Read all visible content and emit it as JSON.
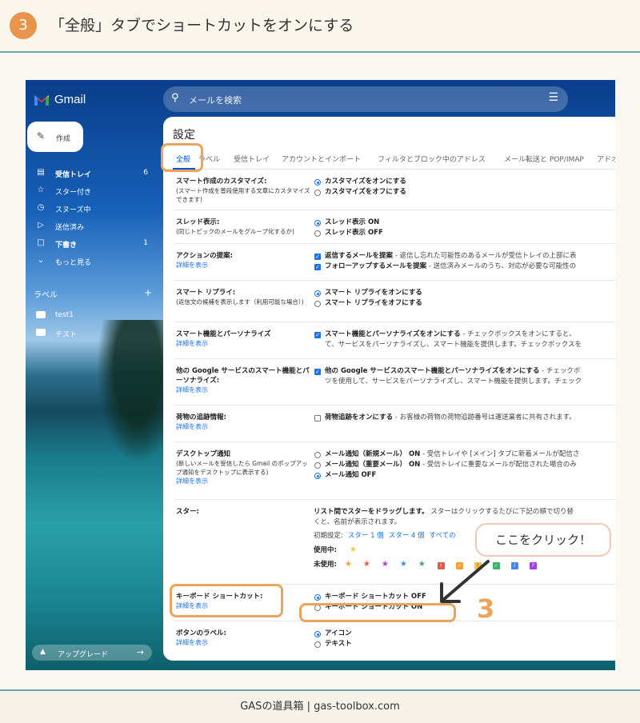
{
  "header": {
    "step": "3",
    "title": "「全般」タブでショートカットをオンにする"
  },
  "gmail": {
    "brand": "Gmail",
    "search_placeholder": "メールを検索",
    "compose": "作成",
    "nav": [
      {
        "label": "受信トレイ",
        "count": "6",
        "icon": "inbox-icon"
      },
      {
        "label": "スター付き",
        "count": "",
        "icon": "star-icon"
      },
      {
        "label": "スヌーズ中",
        "count": "",
        "icon": "clock-icon"
      },
      {
        "label": "送信済み",
        "count": "",
        "icon": "send-icon"
      },
      {
        "label": "下書き",
        "count": "1",
        "icon": "draft-icon"
      },
      {
        "label": "もっと見る",
        "count": "",
        "icon": "chevron-down-icon"
      }
    ],
    "labels_heading": "ラベル",
    "labels": [
      "test1",
      "テスト"
    ],
    "upgrade": "アップグレード"
  },
  "settings": {
    "title": "設定",
    "tabs": [
      "全般",
      "ラベル",
      "受信トレイ",
      "アカウントとインポート",
      "フィルタとブロック中のアドレス",
      "メール転送と POP/IMAP",
      "アドオ"
    ],
    "details_link": "詳細を表示",
    "smart_compose": {
      "label": "スマート作成のカスタマイズ:",
      "sub": "(スマート作成を普段使用する文章にカスタマイズできます)",
      "opt_on": "カスタマイズをオンにする",
      "opt_off": "カスタマイズをオフにする"
    },
    "thread": {
      "label": "スレッド表示:",
      "sub": "(同じトピックのメールをグループ化するか)",
      "opt_on": "スレッド表示 ON",
      "opt_off": "スレッド表示 OFF"
    },
    "nudges": {
      "label": "アクションの提案:",
      "opt1": "返信するメールを提案",
      "opt1_desc": " - 返信し忘れた可能性のあるメールが受信トレイの上部に表",
      "opt2": "フォローアップするメールを提案",
      "opt2_desc": " - 送信済みメールのうち、対応が必要な可能性の"
    },
    "smart_reply": {
      "label": "スマート リプライ:",
      "sub": "(返信文の候補を表示します（利用可能な場合）)",
      "opt_on": "スマート リプライをオンにする",
      "opt_off": "スマート リプライをオフにする"
    },
    "smart_features": {
      "label": "スマート機能とパーソナライズ",
      "opt": "スマート機能とパーソナライズをオンにする",
      "desc1": " - チェックボックスをオンにすると、",
      "desc2": "て、サービスをパーソナライズし、スマート機能を提供します。チェックボックスを"
    },
    "google_smart": {
      "label": "他の Google サービスのスマート機能とパーソナライズ:",
      "opt": "他の Google サービスのスマート機能とパーソナライズをオンにする",
      "desc1": " - チェックボ",
      "desc2": "ツを使用して、サービスをパーソナライズし、スマート機能を提供します。チェック"
    },
    "package": {
      "label": "荷物の追跡情報:",
      "opt": "荷物追跡をオンにする",
      "desc": " - お客様の荷物の荷物追跡番号は運送業者に共有されます。"
    },
    "desktop": {
      "label": "デスクトップ通知",
      "sub": "(新しいメールを受信したら Gmail のポップアップ通知をデスクトップに表示する)",
      "opt1": "メール通知（新規メール） ON",
      "opt1_desc": " - 受信トレイや [メイン] タブに新着メールが配信さ",
      "opt2": "メール通知（重要メール） ON",
      "opt2_desc": " - 受信トレイに重要なメールが配信された場合のみ",
      "opt3": "メール通知 OFF"
    },
    "stars": {
      "label": "スター:",
      "line1": "リスト間でスターをドラッグします。",
      "line1_desc": " スターはクリックするたびに下記の順で切り替",
      "line2": "くと、名前が表示されます。",
      "preset": "初期設定:",
      "preset_1": "スター 1 個",
      "preset_4": "スター 4 個",
      "preset_all": "すべての",
      "in_use": "使用中:",
      "not_in_use": "未使用:"
    },
    "shortcuts": {
      "label": "キーボード ショートカット:",
      "opt_off": "キーボード ショートカット OFF",
      "opt_on": "キーボード ショートカット ON"
    },
    "button_labels": {
      "label": "ボタンのラベル:",
      "opt_icon": "アイコン",
      "opt_text": "テキスト"
    }
  },
  "annotation": {
    "bubble": "ここをクリック！",
    "number": "3",
    "color": "#eca45c"
  },
  "footer": "GASの道具箱 | gas-toolbox.com"
}
